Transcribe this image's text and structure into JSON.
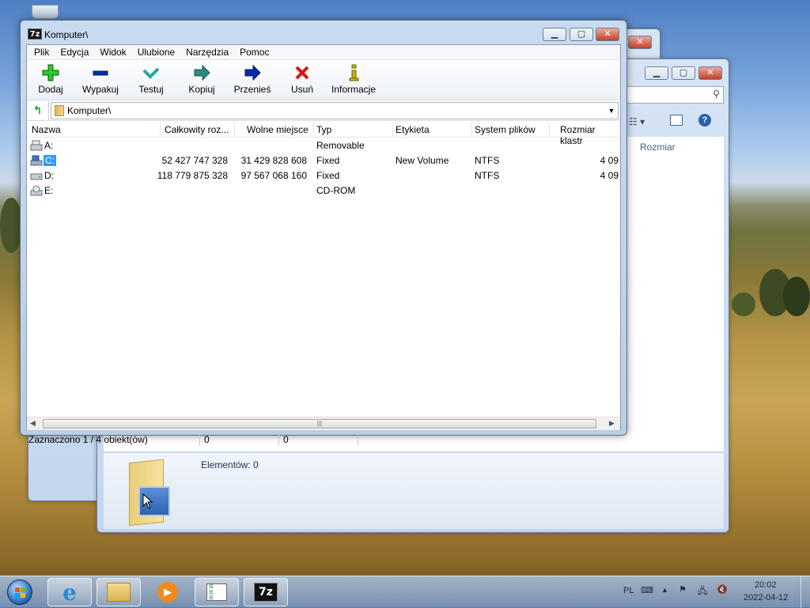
{
  "window": {
    "title": "Komputer\\",
    "menu": [
      "Plik",
      "Edycja",
      "Widok",
      "Ulubione",
      "Narzędzia",
      "Pomoc"
    ],
    "toolbar": [
      {
        "label": "Dodaj",
        "icon": "add-icon"
      },
      {
        "label": "Wypakuj",
        "icon": "extract-icon"
      },
      {
        "label": "Testuj",
        "icon": "test-icon"
      },
      {
        "label": "Kopiuj",
        "icon": "copy-icon"
      },
      {
        "label": "Przenieś",
        "icon": "move-icon"
      },
      {
        "label": "Usuń",
        "icon": "delete-icon"
      },
      {
        "label": "Informacje",
        "icon": "info-icon"
      }
    ],
    "address": "Komputer\\",
    "columns": [
      "Nazwa",
      "Całkowity roz...",
      "Wolne miejsce",
      "Typ",
      "Etykieta",
      "System plików",
      "Rozmiar klastr"
    ],
    "rows": [
      {
        "name": "A:",
        "total": "",
        "free": "",
        "type": "Removable",
        "label": "",
        "fs": "",
        "cluster": "",
        "icon": "floppy-drive-icon"
      },
      {
        "name": "C:",
        "total": "52 427 747 328",
        "free": "31 429 828 608",
        "type": "Fixed",
        "label": "New Volume",
        "fs": "NTFS",
        "cluster": "4 09",
        "icon": "system-drive-icon"
      },
      {
        "name": "D:",
        "total": "118 779 875 328",
        "free": "97 567 068 160",
        "type": "Fixed",
        "label": "",
        "fs": "NTFS",
        "cluster": "4 09",
        "icon": "hard-drive-icon"
      },
      {
        "name": "E:",
        "total": "",
        "free": "",
        "type": "CD-ROM",
        "label": "",
        "fs": "",
        "cluster": "",
        "icon": "cd-drive-icon"
      }
    ],
    "selected_row": "C:",
    "status": {
      "selection": "Zaznaczono 1 / 4 obiekt(ów)",
      "size1": "0",
      "size2": "0"
    }
  },
  "explorer": {
    "column_size": "Rozmiar",
    "items_count": "Elementów: 0"
  },
  "taskbar": {
    "language": "PL",
    "time": "20:02",
    "date": "2022-04-12",
    "apps": [
      "start-orb",
      "internet-explorer",
      "file-explorer",
      "media-player",
      "notepad-list",
      "7zip"
    ],
    "active_app": "7zip"
  },
  "colors": {
    "selection": "#3399ff",
    "add": "#22aa22",
    "extract": "#0b2aa8",
    "test": "#29a8a0",
    "delete": "#dd1111",
    "info": "#c8b400"
  }
}
